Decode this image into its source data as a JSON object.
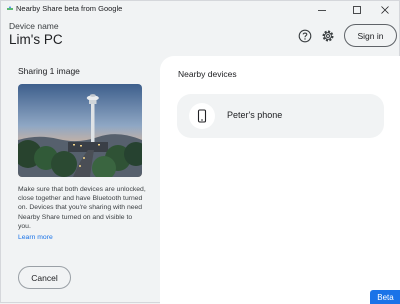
{
  "window": {
    "title": "Nearby Share beta from Google"
  },
  "header": {
    "device_label": "Device name",
    "device_name": "Lim's PC",
    "help_icon": "help-circle-icon",
    "settings_icon": "gear-icon",
    "signin_label": "Sign in"
  },
  "left": {
    "sharing_title": "Sharing 1 image",
    "info_text": "Make sure that both devices are unlocked, close together and have Bluetooth turned on. Devices that you're sharing with need Nearby Share turned on and visible to you.",
    "learn_more": "Learn more",
    "cancel_label": "Cancel"
  },
  "right": {
    "nearby_title": "Nearby devices",
    "devices": [
      {
        "name": "Peter's phone",
        "icon": "smartphone-icon"
      }
    ]
  },
  "beta_label": "Beta",
  "colors": {
    "accent": "#1a73e8",
    "background": "#f1f3f4",
    "panel": "#ffffff"
  }
}
